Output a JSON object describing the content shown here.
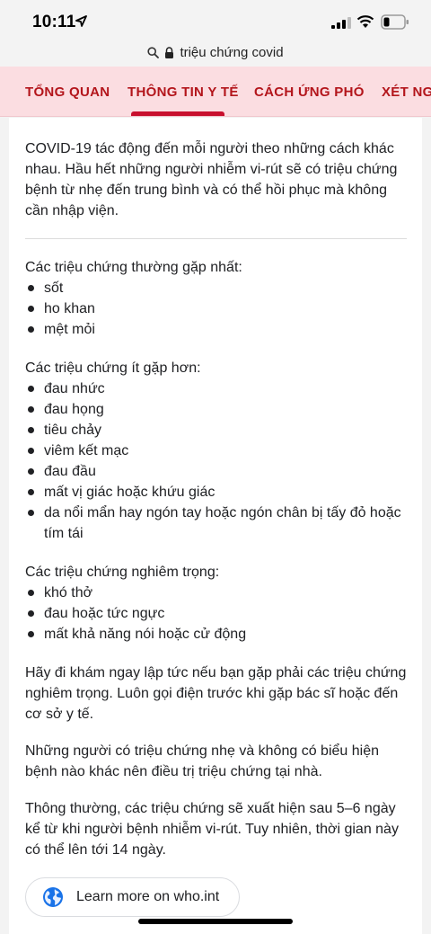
{
  "status_bar": {
    "time": "10:11"
  },
  "url_bar": {
    "text": "triệu chứng covid"
  },
  "tabs": [
    {
      "label": "TỔNG QUAN"
    },
    {
      "label": "THÔNG TIN Y TẾ"
    },
    {
      "label": "CÁCH ỨNG PHÓ"
    },
    {
      "label": "XÉT NGH"
    }
  ],
  "selected_tab_index": 1,
  "content": {
    "intro": "COVID-19 tác động đến mỗi người theo những cách khác nhau. Hầu hết những người nhiễm vi-rút sẽ có triệu chứng bệnh từ nhẹ đến trung bình và có thể hồi phục mà không cần nhập viện.",
    "common": {
      "heading": "Các triệu chứng thường gặp nhất:",
      "items": [
        "sốt",
        "ho khan",
        "mệt mỏi"
      ]
    },
    "less_common": {
      "heading": "Các triệu chứng ít gặp hơn:",
      "items": [
        "đau nhức",
        "đau họng",
        "tiêu chảy",
        "viêm kết mạc",
        "đau đầu",
        "mất vị giác hoặc khứu giác",
        "da nổi mẩn hay ngón tay hoặc ngón chân bị tấy đỏ hoặc tím tái"
      ]
    },
    "serious": {
      "heading": "Các triệu chứng nghiêm trọng:",
      "items": [
        "khó thở",
        "đau hoặc tức ngực",
        "mất khả năng nói hoặc cử động"
      ]
    },
    "advice": "Hãy đi khám ngay lập tức nếu bạn gặp phải các triệu chứng nghiêm trọng. Luôn gọi điện trước khi gặp bác sĩ hoặc đến cơ sở y tế.",
    "mild": "Những người có triệu chứng nhẹ và không có biểu hiện bệnh nào khác nên điều trị triệu chứng tại nhà.",
    "timing": "Thông thường, các triệu chứng sẽ xuất hiện sau 5–6 ngày kể từ khi người bệnh nhiễm vi-rút. Tuy nhiên, thời gian này có thể lên tới 14 ngày.",
    "learn_more_label": "Learn more on who.int"
  },
  "colors": {
    "tab_bar_bg": "#fbdde1",
    "tab_text": "#b3151b",
    "tab_indicator": "#c8102e",
    "link_globe": "#1a73e8"
  }
}
